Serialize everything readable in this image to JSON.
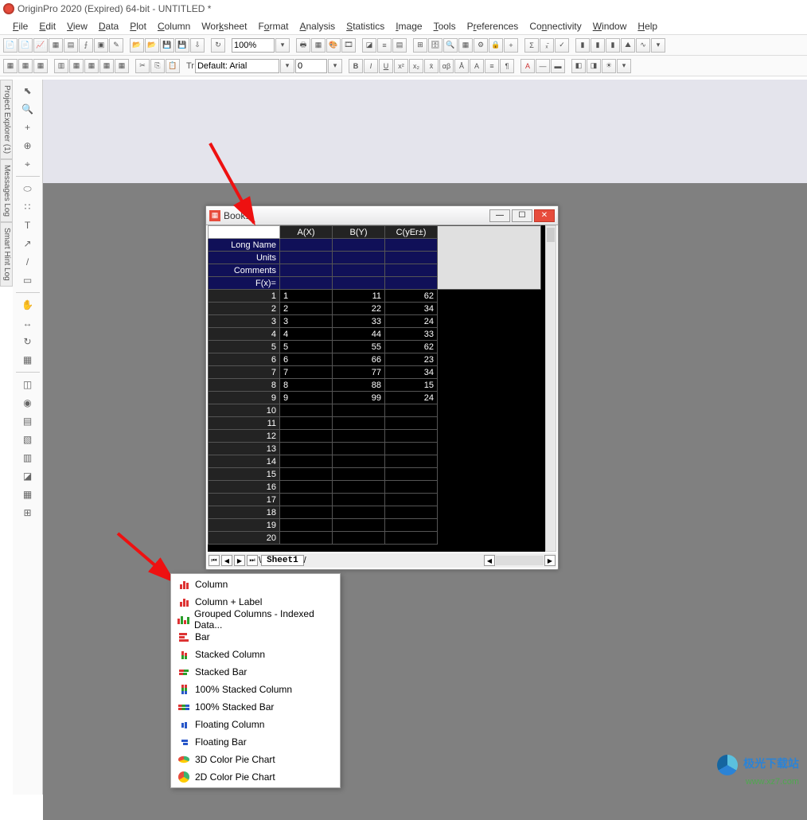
{
  "app": {
    "title": "OriginPro 2020 (Expired) 64-bit - UNTITLED *"
  },
  "menus": [
    "File",
    "Edit",
    "View",
    "Data",
    "Plot",
    "Column",
    "Worksheet",
    "Format",
    "Analysis",
    "Statistics",
    "Image",
    "Tools",
    "Preferences",
    "Connectivity",
    "Window",
    "Help"
  ],
  "toolbar2": {
    "zoom": "100%",
    "font": "Default: Arial",
    "fontsize": "0"
  },
  "leftpanels": [
    "Project Explorer (1)",
    "Messages Log",
    "Smart Hint Log"
  ],
  "book": {
    "title": "Book1",
    "cols": [
      "A(X)",
      "B(Y)",
      "C(yEr±)"
    ],
    "meta": [
      "Long Name",
      "Units",
      "Comments",
      "F(x)="
    ],
    "rows": [
      {
        "n": "1",
        "a": "1",
        "b": "11",
        "c": "62"
      },
      {
        "n": "2",
        "a": "2",
        "b": "22",
        "c": "34"
      },
      {
        "n": "3",
        "a": "3",
        "b": "33",
        "c": "24"
      },
      {
        "n": "4",
        "a": "4",
        "b": "44",
        "c": "33"
      },
      {
        "n": "5",
        "a": "5",
        "b": "55",
        "c": "62"
      },
      {
        "n": "6",
        "a": "6",
        "b": "66",
        "c": "23"
      },
      {
        "n": "7",
        "a": "7",
        "b": "77",
        "c": "34"
      },
      {
        "n": "8",
        "a": "8",
        "b": "88",
        "c": "15"
      },
      {
        "n": "9",
        "a": "9",
        "b": "99",
        "c": "24"
      },
      {
        "n": "10",
        "a": "",
        "b": "",
        "c": ""
      },
      {
        "n": "11",
        "a": "",
        "b": "",
        "c": ""
      },
      {
        "n": "12",
        "a": "",
        "b": "",
        "c": ""
      },
      {
        "n": "13",
        "a": "",
        "b": "",
        "c": ""
      },
      {
        "n": "14",
        "a": "",
        "b": "",
        "c": ""
      },
      {
        "n": "15",
        "a": "",
        "b": "",
        "c": ""
      },
      {
        "n": "16",
        "a": "",
        "b": "",
        "c": ""
      },
      {
        "n": "17",
        "a": "",
        "b": "",
        "c": ""
      },
      {
        "n": "18",
        "a": "",
        "b": "",
        "c": ""
      },
      {
        "n": "19",
        "a": "",
        "b": "",
        "c": ""
      },
      {
        "n": "20",
        "a": "",
        "b": "",
        "c": ""
      }
    ],
    "sheet_tab": "Sheet1"
  },
  "ctx": {
    "items": [
      "Column",
      "Column + Label",
      "Grouped Columns - Indexed Data...",
      "Bar",
      "Stacked Column",
      "Stacked Bar",
      "100% Stacked Column",
      "100% Stacked Bar",
      "Floating Column",
      "Floating Bar",
      "3D Color Pie Chart",
      "2D Color Pie Chart"
    ]
  },
  "watermark": {
    "brand": "极光下载站",
    "url": "www.xz7.com"
  }
}
